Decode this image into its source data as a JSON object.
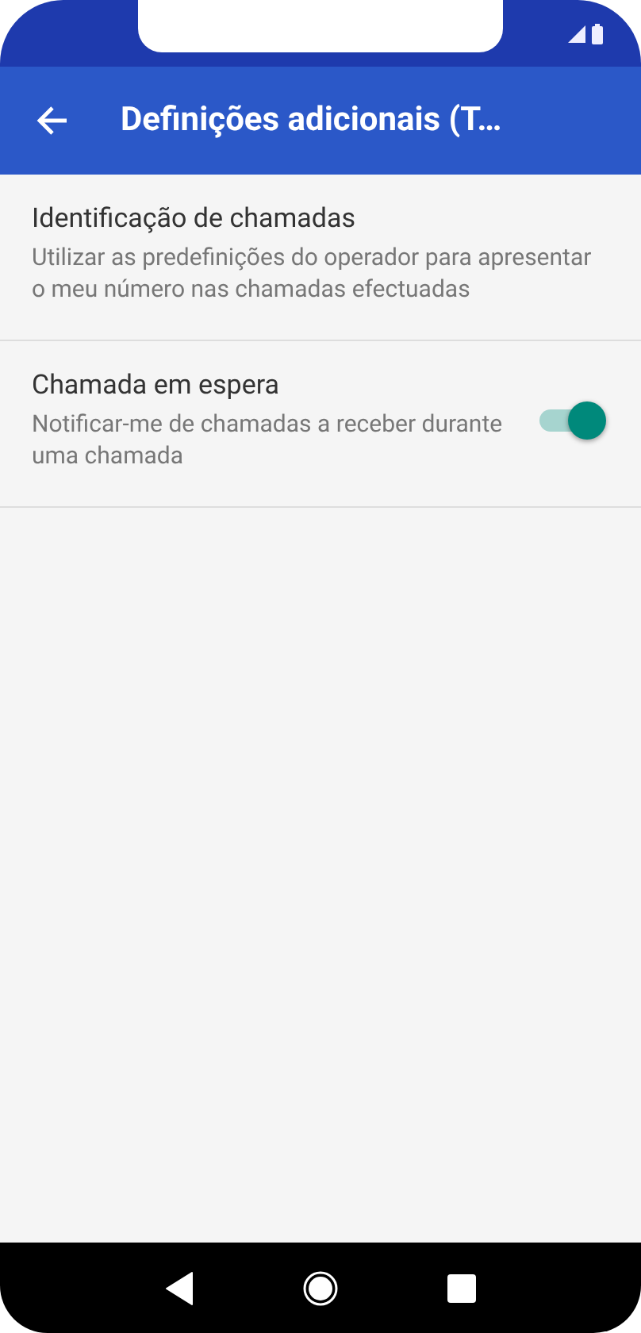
{
  "app_bar": {
    "title": "Definições adicionais (T…"
  },
  "settings": [
    {
      "kind": "text",
      "title": "Identificação de chamadas",
      "summary": "Utilizar as predefinições do operador para apresentar o meu número nas chamadas efectuadas"
    },
    {
      "kind": "switch",
      "title": "Chamada em espera",
      "summary": "Notificar-me de chamadas a receber durante uma chamada",
      "on": true
    }
  ]
}
